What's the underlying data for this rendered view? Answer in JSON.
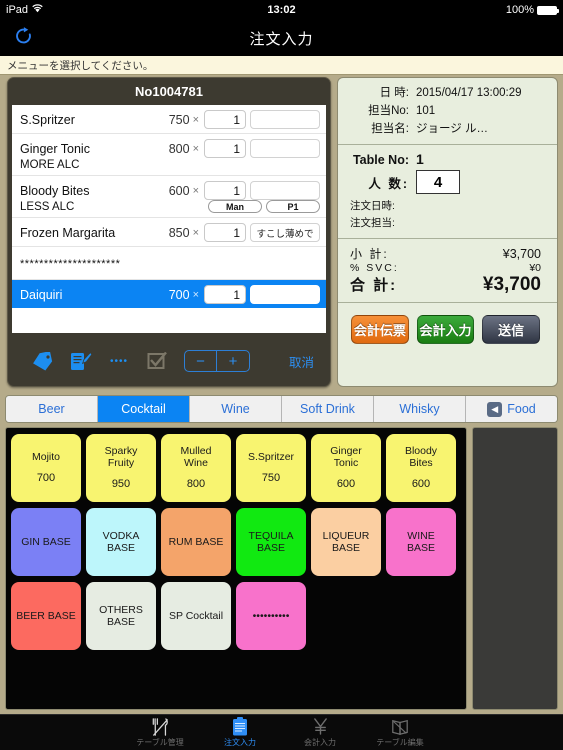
{
  "status_bar": {
    "device": "iPad",
    "wifi_icon": "wifi-icon",
    "clock": "13:02",
    "battery_text": "100%"
  },
  "nav": {
    "refresh_icon": "refresh-icon",
    "title": "注文入力"
  },
  "message_bar": {
    "text": "メニューを選択してください。"
  },
  "order": {
    "header": "No1004781",
    "items": [
      {
        "name": "S.Spritzer",
        "sub": "",
        "price": "750",
        "mult": "×",
        "qty": "1",
        "note": "",
        "badges": [],
        "selected": false
      },
      {
        "name": "Ginger Tonic",
        "sub": "MORE ALC",
        "price": "800",
        "mult": "×",
        "qty": "1",
        "note": "",
        "badges": [],
        "selected": false
      },
      {
        "name": "Bloody Bites",
        "sub": "LESS ALC",
        "price": "600",
        "mult": "×",
        "qty": "1",
        "note": "",
        "badges": [
          "Man",
          "P1"
        ],
        "selected": false
      },
      {
        "name": "Frozen Margarita",
        "sub": "",
        "price": "850",
        "mult": "×",
        "qty": "1",
        "note": "すこし薄めで",
        "badges": [],
        "selected": false
      }
    ],
    "separator_text": "*********************",
    "selected_item": {
      "name": "Daiquiri",
      "price": "700",
      "mult": "×",
      "qty": "1",
      "note": ""
    },
    "toolbar": {
      "tag_icon": "tag-icon",
      "memo_icon": "memo-edit-icon",
      "dots_label": "••••",
      "check_icon": "checkbox-icon",
      "minus_label": "−",
      "plus_label": "+",
      "cancel_label": "取消"
    }
  },
  "info": {
    "datetime_label": "日 時:",
    "datetime_value": "2015/04/17 13:00:29",
    "staff_no_label": "担当No:",
    "staff_no_value": "101",
    "staff_name_label": "担当名:",
    "staff_name_value": "ジョージ ル…",
    "table_no_label": "Table No:",
    "table_no_value": "1",
    "guests_label": "人 数:",
    "guests_value": "4",
    "order_datetime_label": "注文日時:",
    "order_datetime_value": "",
    "order_staff_label": "注文担当:",
    "order_staff_value": "",
    "subtotal_label": "小 計:",
    "subtotal_value": "¥3,700",
    "svc_label": "% SVC:",
    "svc_value": "¥0",
    "total_label": "合 計:",
    "total_value": "¥3,700",
    "buttons": [
      {
        "label": "会計伝票",
        "style": "orange"
      },
      {
        "label": "会計入力",
        "style": "green"
      },
      {
        "label": "送信",
        "style": "dark"
      }
    ]
  },
  "category_tabs": [
    {
      "label": "Beer",
      "active": false,
      "icon": ""
    },
    {
      "label": "Cocktail",
      "active": true,
      "icon": ""
    },
    {
      "label": "Wine",
      "active": false,
      "icon": ""
    },
    {
      "label": "Soft Drink",
      "active": false,
      "icon": ""
    },
    {
      "label": "Whisky",
      "active": false,
      "icon": ""
    },
    {
      "label": "Food",
      "active": false,
      "icon": "arrow-left-icon"
    }
  ],
  "menu_grid": {
    "buttons": [
      {
        "name": "Mojito",
        "price": "700",
        "color": "#f8f470"
      },
      {
        "name": "Sparky\nFruity",
        "price": "950",
        "color": "#f8f470"
      },
      {
        "name": "Mulled\nWine",
        "price": "800",
        "color": "#f8f470"
      },
      {
        "name": "S.Spritzer",
        "price": "750",
        "color": "#f8f470"
      },
      {
        "name": "Ginger\nTonic",
        "price": "600",
        "color": "#f8f470"
      },
      {
        "name": "Bloody\nBites",
        "price": "600",
        "color": "#f8f470"
      },
      {
        "name": "GIN BASE",
        "price": "",
        "color": "#7b80f5"
      },
      {
        "name": "VODKA\nBASE",
        "price": "",
        "color": "#bdf6fb"
      },
      {
        "name": "RUM BASE",
        "price": "",
        "color": "#f4a46a"
      },
      {
        "name": "TEQUILA\nBASE",
        "price": "",
        "color": "#11e911"
      },
      {
        "name": "LIQUEUR\nBASE",
        "price": "",
        "color": "#fbcfa2"
      },
      {
        "name": "WINE\nBASE",
        "price": "",
        "color": "#f872cb"
      },
      {
        "name": "BEER BASE",
        "price": "",
        "color": "#fc6a60"
      },
      {
        "name": "OTHERS\nBASE",
        "price": "",
        "color": "#e6ece2"
      },
      {
        "name": "SP Cocktail",
        "price": "",
        "color": "#e6ece2"
      },
      {
        "name": "••••••••••",
        "price": "",
        "color": "#f872cb"
      }
    ]
  },
  "bottom_tabs": [
    {
      "label": "テーブル管理",
      "icon": "fork-knife-icon",
      "active": false
    },
    {
      "label": "注文入力",
      "icon": "clipboard-icon",
      "active": true
    },
    {
      "label": "会計入力",
      "icon": "yen-icon",
      "active": false
    },
    {
      "label": "テーブル編集",
      "icon": "book-icon",
      "active": false
    }
  ],
  "colors": {
    "accent": "#0b84f3",
    "background": "#b5ab8a",
    "panel": "#3d3a30",
    "info_panel": "#e8eede"
  }
}
